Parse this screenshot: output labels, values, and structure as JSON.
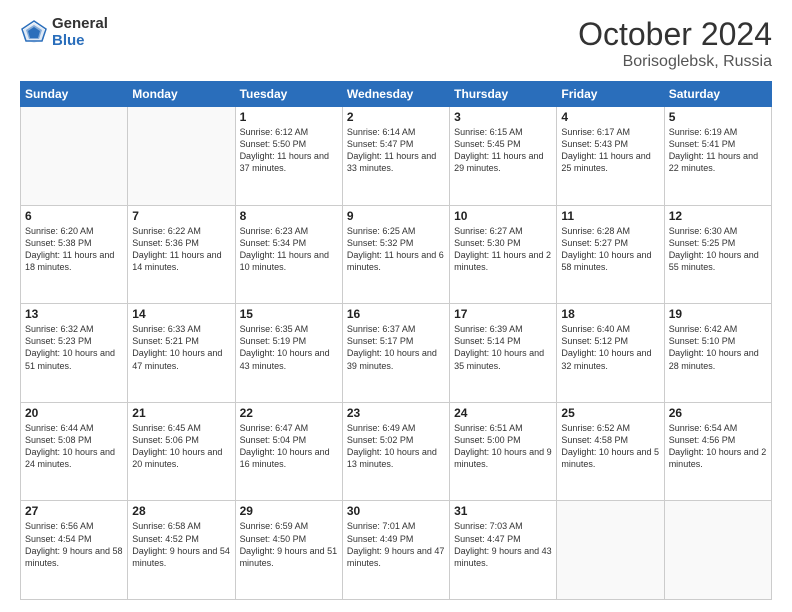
{
  "header": {
    "logo_general": "General",
    "logo_blue": "Blue",
    "month": "October 2024",
    "location": "Borisoglebsk, Russia"
  },
  "weekdays": [
    "Sunday",
    "Monday",
    "Tuesday",
    "Wednesday",
    "Thursday",
    "Friday",
    "Saturday"
  ],
  "weeks": [
    [
      {
        "day": "",
        "info": ""
      },
      {
        "day": "",
        "info": ""
      },
      {
        "day": "1",
        "info": "Sunrise: 6:12 AM\nSunset: 5:50 PM\nDaylight: 11 hours and 37 minutes."
      },
      {
        "day": "2",
        "info": "Sunrise: 6:14 AM\nSunset: 5:47 PM\nDaylight: 11 hours and 33 minutes."
      },
      {
        "day": "3",
        "info": "Sunrise: 6:15 AM\nSunset: 5:45 PM\nDaylight: 11 hours and 29 minutes."
      },
      {
        "day": "4",
        "info": "Sunrise: 6:17 AM\nSunset: 5:43 PM\nDaylight: 11 hours and 25 minutes."
      },
      {
        "day": "5",
        "info": "Sunrise: 6:19 AM\nSunset: 5:41 PM\nDaylight: 11 hours and 22 minutes."
      }
    ],
    [
      {
        "day": "6",
        "info": "Sunrise: 6:20 AM\nSunset: 5:38 PM\nDaylight: 11 hours and 18 minutes."
      },
      {
        "day": "7",
        "info": "Sunrise: 6:22 AM\nSunset: 5:36 PM\nDaylight: 11 hours and 14 minutes."
      },
      {
        "day": "8",
        "info": "Sunrise: 6:23 AM\nSunset: 5:34 PM\nDaylight: 11 hours and 10 minutes."
      },
      {
        "day": "9",
        "info": "Sunrise: 6:25 AM\nSunset: 5:32 PM\nDaylight: 11 hours and 6 minutes."
      },
      {
        "day": "10",
        "info": "Sunrise: 6:27 AM\nSunset: 5:30 PM\nDaylight: 11 hours and 2 minutes."
      },
      {
        "day": "11",
        "info": "Sunrise: 6:28 AM\nSunset: 5:27 PM\nDaylight: 10 hours and 58 minutes."
      },
      {
        "day": "12",
        "info": "Sunrise: 6:30 AM\nSunset: 5:25 PM\nDaylight: 10 hours and 55 minutes."
      }
    ],
    [
      {
        "day": "13",
        "info": "Sunrise: 6:32 AM\nSunset: 5:23 PM\nDaylight: 10 hours and 51 minutes."
      },
      {
        "day": "14",
        "info": "Sunrise: 6:33 AM\nSunset: 5:21 PM\nDaylight: 10 hours and 47 minutes."
      },
      {
        "day": "15",
        "info": "Sunrise: 6:35 AM\nSunset: 5:19 PM\nDaylight: 10 hours and 43 minutes."
      },
      {
        "day": "16",
        "info": "Sunrise: 6:37 AM\nSunset: 5:17 PM\nDaylight: 10 hours and 39 minutes."
      },
      {
        "day": "17",
        "info": "Sunrise: 6:39 AM\nSunset: 5:14 PM\nDaylight: 10 hours and 35 minutes."
      },
      {
        "day": "18",
        "info": "Sunrise: 6:40 AM\nSunset: 5:12 PM\nDaylight: 10 hours and 32 minutes."
      },
      {
        "day": "19",
        "info": "Sunrise: 6:42 AM\nSunset: 5:10 PM\nDaylight: 10 hours and 28 minutes."
      }
    ],
    [
      {
        "day": "20",
        "info": "Sunrise: 6:44 AM\nSunset: 5:08 PM\nDaylight: 10 hours and 24 minutes."
      },
      {
        "day": "21",
        "info": "Sunrise: 6:45 AM\nSunset: 5:06 PM\nDaylight: 10 hours and 20 minutes."
      },
      {
        "day": "22",
        "info": "Sunrise: 6:47 AM\nSunset: 5:04 PM\nDaylight: 10 hours and 16 minutes."
      },
      {
        "day": "23",
        "info": "Sunrise: 6:49 AM\nSunset: 5:02 PM\nDaylight: 10 hours and 13 minutes."
      },
      {
        "day": "24",
        "info": "Sunrise: 6:51 AM\nSunset: 5:00 PM\nDaylight: 10 hours and 9 minutes."
      },
      {
        "day": "25",
        "info": "Sunrise: 6:52 AM\nSunset: 4:58 PM\nDaylight: 10 hours and 5 minutes."
      },
      {
        "day": "26",
        "info": "Sunrise: 6:54 AM\nSunset: 4:56 PM\nDaylight: 10 hours and 2 minutes."
      }
    ],
    [
      {
        "day": "27",
        "info": "Sunrise: 6:56 AM\nSunset: 4:54 PM\nDaylight: 9 hours and 58 minutes."
      },
      {
        "day": "28",
        "info": "Sunrise: 6:58 AM\nSunset: 4:52 PM\nDaylight: 9 hours and 54 minutes."
      },
      {
        "day": "29",
        "info": "Sunrise: 6:59 AM\nSunset: 4:50 PM\nDaylight: 9 hours and 51 minutes."
      },
      {
        "day": "30",
        "info": "Sunrise: 7:01 AM\nSunset: 4:49 PM\nDaylight: 9 hours and 47 minutes."
      },
      {
        "day": "31",
        "info": "Sunrise: 7:03 AM\nSunset: 4:47 PM\nDaylight: 9 hours and 43 minutes."
      },
      {
        "day": "",
        "info": ""
      },
      {
        "day": "",
        "info": ""
      }
    ]
  ]
}
